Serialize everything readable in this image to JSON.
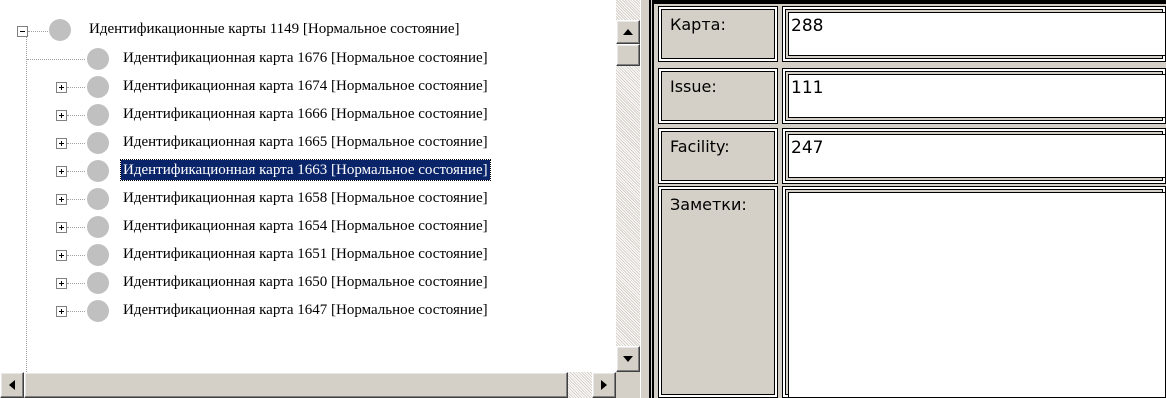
{
  "tree": {
    "root": {
      "label": "Идентификационные карты 1149 [Нормальное состояние]",
      "expander": "minus"
    },
    "children": [
      {
        "label": "Идентификационная карта 1676 [Нормальное состояние]",
        "expander": "none",
        "selected": false
      },
      {
        "label": "Идентификационная карта 1674 [Нормальное состояние]",
        "expander": "plus",
        "selected": false
      },
      {
        "label": "Идентификационная карта 1666 [Нормальное состояние]",
        "expander": "plus",
        "selected": false
      },
      {
        "label": "Идентификационная карта 1665 [Нормальное состояние]",
        "expander": "plus",
        "selected": false
      },
      {
        "label": "Идентификационная карта 1663 [Нормальное состояние]",
        "expander": "plus",
        "selected": true
      },
      {
        "label": "Идентификационная карта 1658 [Нормальное состояние]",
        "expander": "plus",
        "selected": false
      },
      {
        "label": "Идентификационная карта 1654 [Нормальное состояние]",
        "expander": "plus",
        "selected": false
      },
      {
        "label": "Идентификационная карта 1651 [Нормальное состояние]",
        "expander": "plus",
        "selected": false
      },
      {
        "label": "Идентификационная карта 1650 [Нормальное состояние]",
        "expander": "plus",
        "selected": false
      },
      {
        "label": "Идентификационная карта 1647 [Нормальное состояние]",
        "expander": "plus",
        "selected": false
      }
    ],
    "node_icon": "gray-circle-icon",
    "scrollbars": {
      "up_icon": "arrow-up-icon",
      "down_icon": "arrow-down-icon",
      "left_icon": "arrow-left-icon",
      "right_icon": "arrow-right-icon"
    }
  },
  "form": {
    "fields": [
      {
        "label": "Карта:",
        "value": "288"
      },
      {
        "label": "Issue:",
        "value": "111"
      },
      {
        "label": "Facility:",
        "value": "247"
      },
      {
        "label": "Заметки:",
        "value": ""
      }
    ]
  },
  "colors": {
    "window_bg": "#d4d0c8",
    "selection_bg": "#0a246a",
    "selection_fg": "#ffffff",
    "node_icon": "#c0c0c0"
  }
}
